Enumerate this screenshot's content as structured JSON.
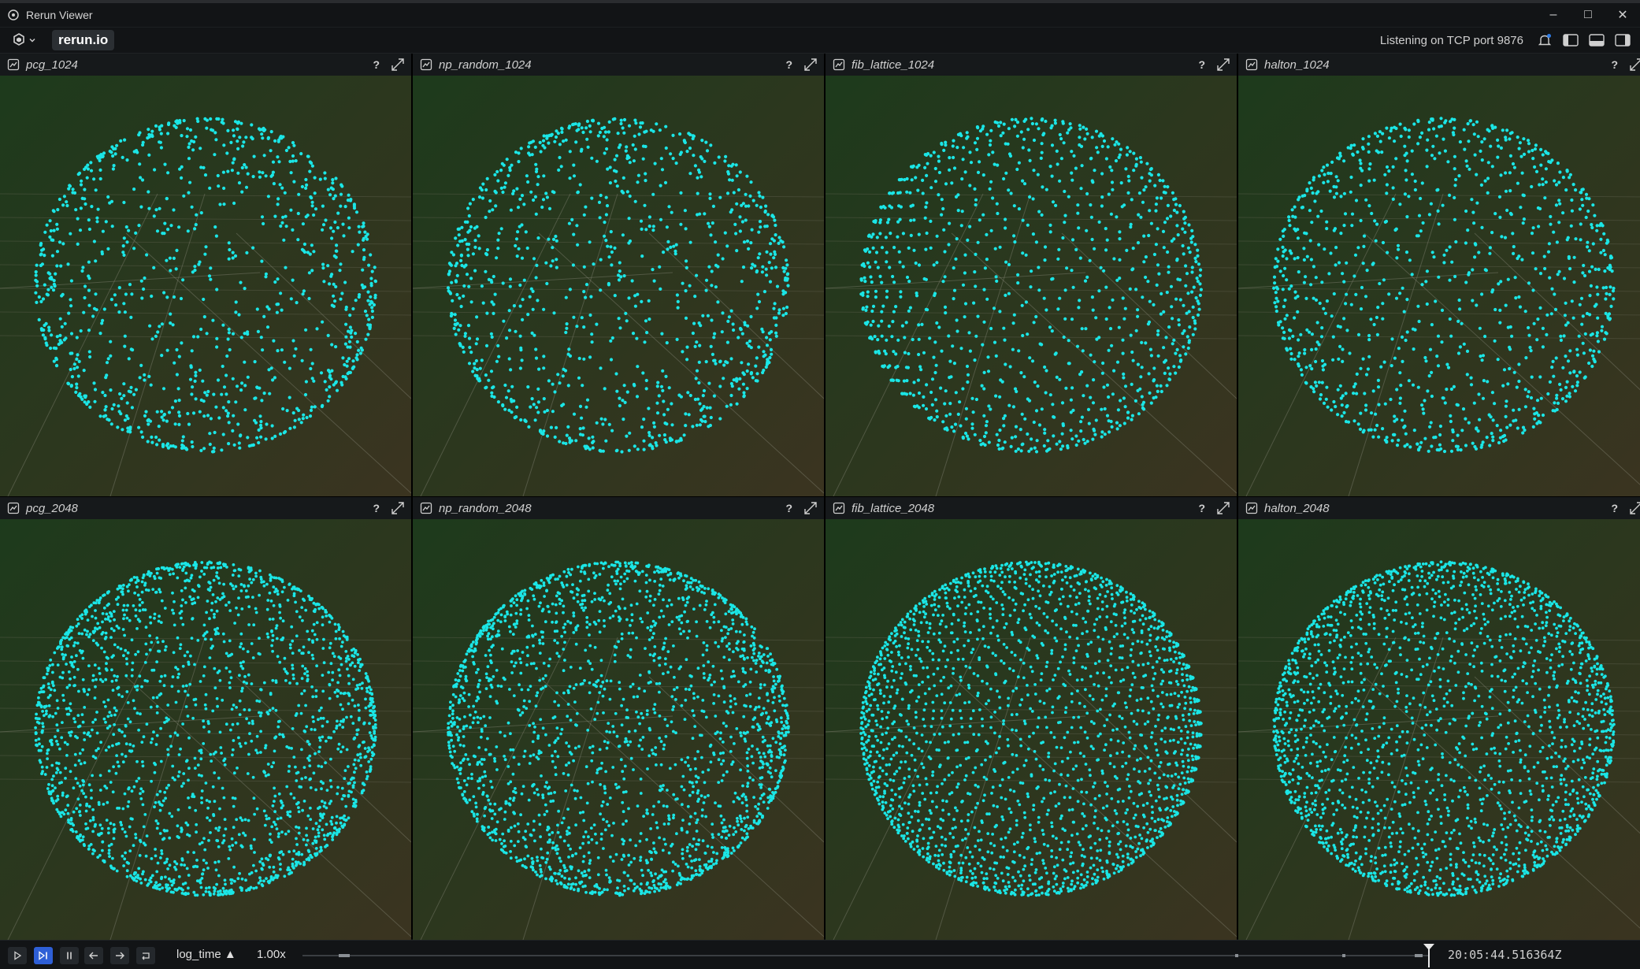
{
  "window": {
    "title": "Rerun Viewer",
    "controls": {
      "minimize": "–",
      "maximize": "□",
      "close": "✕"
    }
  },
  "top_panel": {
    "brand": "rerun.io",
    "status": "Listening on TCP port 9876",
    "icons": [
      "rerun-logo-menu-icon",
      "notifications-icon",
      "left-panel-toggle-icon",
      "bottom-panel-toggle-icon",
      "right-panel-toggle-icon"
    ]
  },
  "colors": {
    "point": "#1be6e6",
    "accent": "#2e5fd6",
    "bg_green": "#1d3a1c",
    "bg_brown": "#3b3420"
  },
  "views": [
    {
      "title": "pcg_1024",
      "help": "?",
      "points": 1024,
      "method": "random"
    },
    {
      "title": "np_random_1024",
      "help": "?",
      "points": 1024,
      "method": "random"
    },
    {
      "title": "fib_lattice_1024",
      "help": "?",
      "points": 1024,
      "method": "fib"
    },
    {
      "title": "halton_1024",
      "help": "?",
      "points": 1024,
      "method": "halton"
    },
    {
      "title": "pcg_2048",
      "help": "?",
      "points": 2048,
      "method": "random"
    },
    {
      "title": "np_random_2048",
      "help": "?",
      "points": 2048,
      "method": "random"
    },
    {
      "title": "fib_lattice_2048",
      "help": "?",
      "points": 2048,
      "method": "fib"
    },
    {
      "title": "halton_2048",
      "help": "?",
      "points": 2048,
      "method": "halton"
    }
  ],
  "timeline": {
    "timeline_name": "log_time ▲",
    "speed": "1.00x",
    "current_time": "20:05:44.516364Z",
    "buttons": [
      "play",
      "follow",
      "pause",
      "step-back",
      "step-forward",
      "loop"
    ]
  }
}
